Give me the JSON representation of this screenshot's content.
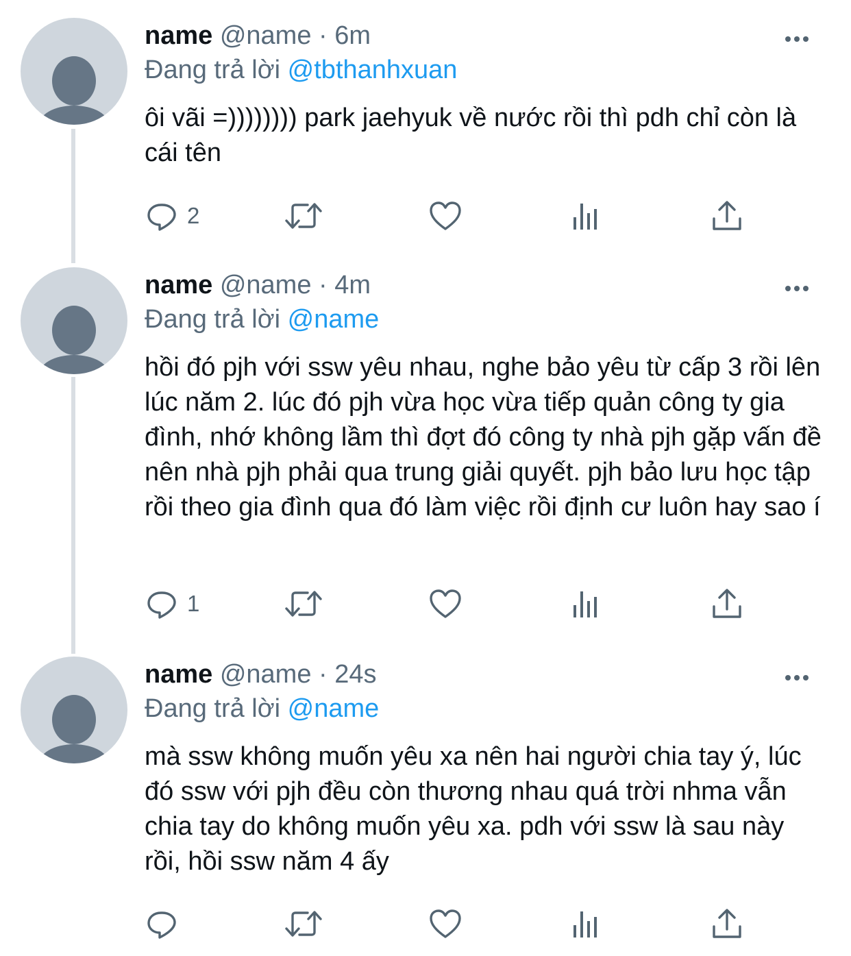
{
  "tweets": [
    {
      "name": "name",
      "handle": "@name",
      "separator": "·",
      "time": "6m",
      "reply_prefix": "Đang trả lời",
      "reply_mention": "@tbthanhxuan",
      "text": "ôi vãi =)))))))) park jaehyuk về nước rồi thì pdh chỉ còn là cái tên",
      "reply_count": "2"
    },
    {
      "name": "name",
      "handle": "@name",
      "separator": "·",
      "time": "4m",
      "reply_prefix": "Đang trả lời",
      "reply_mention": "@name",
      "text": "hồi đó pjh với ssw yêu nhau, nghe bảo yêu từ cấp 3 rồi lên lúc năm 2. lúc đó pjh vừa học vừa tiếp quản công ty gia đình, nhớ không lầm thì đợt đó công ty nhà pjh gặp vấn đề nên nhà pjh phải qua trung giải quyết. pjh bảo lưu học tập rồi theo gia đình qua đó làm việc rồi định cư luôn hay sao í",
      "reply_count": "1"
    },
    {
      "name": "name",
      "handle": "@name",
      "separator": "·",
      "time": "24s",
      "reply_prefix": "Đang trả lời",
      "reply_mention": "@name",
      "text": "mà ssw không muốn yêu xa nên hai người chia tay ý, lúc đó ssw với pjh đều còn thương nhau quá trời nhma vẫn chia tay do không muốn yêu xa. pdh với ssw là sau này rồi, hồi ssw năm 4 ấy",
      "reply_count": ""
    }
  ],
  "icons": {
    "reply": "reply-icon",
    "retweet": "retweet-icon",
    "like": "like-icon",
    "analytics": "analytics-icon",
    "share": "share-icon",
    "more": "more-icon"
  },
  "colors": {
    "text": "#0f1419",
    "secondary": "#586a7a",
    "mention": "#1d9bf0",
    "icon": "#536471",
    "avatar_bg": "#cfd6dd",
    "avatar_fg": "#667686",
    "thread_line": "#d9dee3"
  }
}
